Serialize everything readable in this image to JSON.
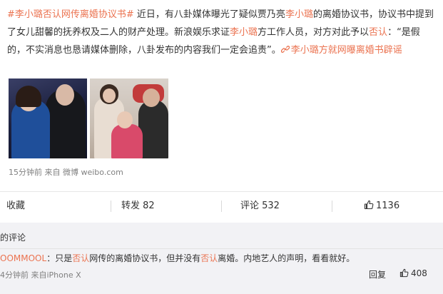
{
  "post": {
    "paragraph": [
      {
        "t": "#李小璐否认网传离婚协议书#",
        "hl": true
      },
      {
        "t": " 近日，有八卦媒体曝光了疑似贾乃亮",
        "hl": false
      },
      {
        "t": "李小璐",
        "hl": true
      },
      {
        "t": "的离婚协议书，协议书中提到了女儿甜馨的抚养权及二人的财产处理。新浪娱乐求证",
        "hl": false
      },
      {
        "t": "李小璐",
        "hl": true
      },
      {
        "t": "方工作人员，对方对此予以",
        "hl": false
      },
      {
        "t": "否认",
        "hl": true
      },
      {
        "t": "：“是假的，不实消息也恳请媒体删除，八卦发布的内容我们一定会追责”。",
        "hl": false
      },
      {
        "t": "李小璐方就网曝离婚书辟谣",
        "hl": true
      }
    ],
    "meta": "15分钟前 来自 微博 weibo.com"
  },
  "actions": {
    "favorite": "收藏",
    "repost": "转发 82",
    "comment": "评论 532",
    "like": "1136"
  },
  "comments": {
    "header": "的评论",
    "username": "OOMMOOL",
    "text_parts": [
      {
        "t": "：只是",
        "hl": false
      },
      {
        "t": "否认",
        "hl": true
      },
      {
        "t": "网传的离婚协议书，但并没有",
        "hl": false
      },
      {
        "t": "否认",
        "hl": true
      },
      {
        "t": "离婚。内地艺人的声明，看看就好。",
        "hl": false
      }
    ],
    "meta": "4分钟前 来自iPhone X",
    "reply": "回复",
    "likes": "408"
  },
  "colors": {
    "accent": "#eb7350",
    "text": "#333333",
    "meta": "#808080",
    "comment_bg": "#f2f2f5"
  },
  "icons": [
    "link-icon",
    "like-icon"
  ]
}
